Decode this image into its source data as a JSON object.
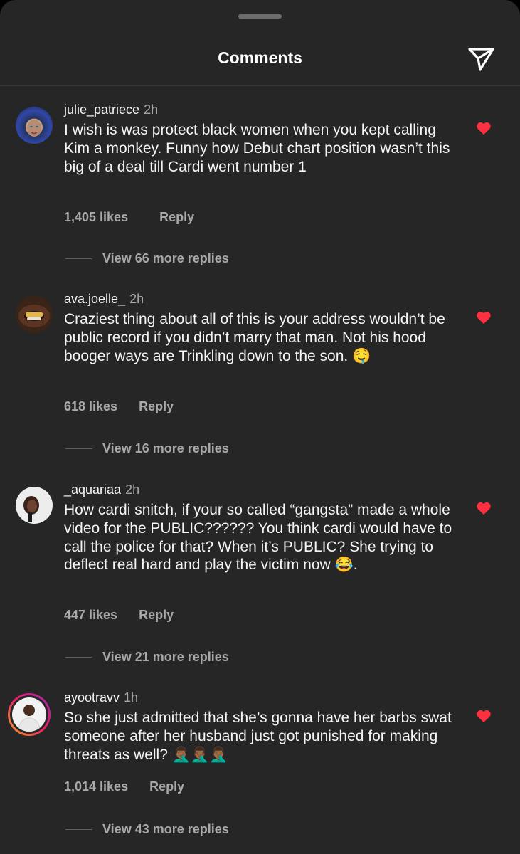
{
  "header": {
    "title": "Comments",
    "send_icon": "paper-plane-icon"
  },
  "colors": {
    "background": "#262626",
    "text_primary": "#f5f5f5",
    "text_secondary": "#a8a8a8",
    "like_red": "#ff3040"
  },
  "comments": [
    {
      "username": "julie_patriece",
      "time": "2h",
      "text": "I wish is was protect black women when you kept calling Kim a monkey. Funny how Debut chart position wasn’t this big of a deal till Cardi went number 1",
      "likes": "1,405 likes",
      "reply_label": "Reply",
      "view_replies": "View 66 more replies",
      "liked": true
    },
    {
      "username": "ava.joelle_",
      "time": "2h",
      "text": "Craziest thing about all of this is your address wouldn’t be public record if you didn’t marry that man. Not his hood booger ways are Trinkling down to the son.",
      "emoji": "🤤",
      "likes": "618 likes",
      "reply_label": "Reply",
      "view_replies": "View 16 more replies",
      "liked": true
    },
    {
      "username": "_aquariaa",
      "time": "2h",
      "text": "How cardi snitch, if your so called “gangsta” made a whole video for the PUBLIC?????? You think cardi would have to call the police for that? When it’s PUBLIC? She trying to deflect real hard and play the victim now",
      "emoji": "😂",
      "text_after": ".",
      "likes": "447 likes",
      "reply_label": "Reply",
      "view_replies": "View 21 more replies",
      "liked": true
    },
    {
      "username": "ayootravv",
      "time": "1h",
      "text": "So she just admitted that she’s gonna have her barbs swat someone after her husband just got punished for making threats as well?",
      "emoji": "🤦🏾‍♂️🤦🏾‍♂️🤦🏾‍♂️",
      "likes": "1,014 likes",
      "reply_label": "Reply",
      "view_replies": "View 43 more replies",
      "liked": true
    }
  ]
}
